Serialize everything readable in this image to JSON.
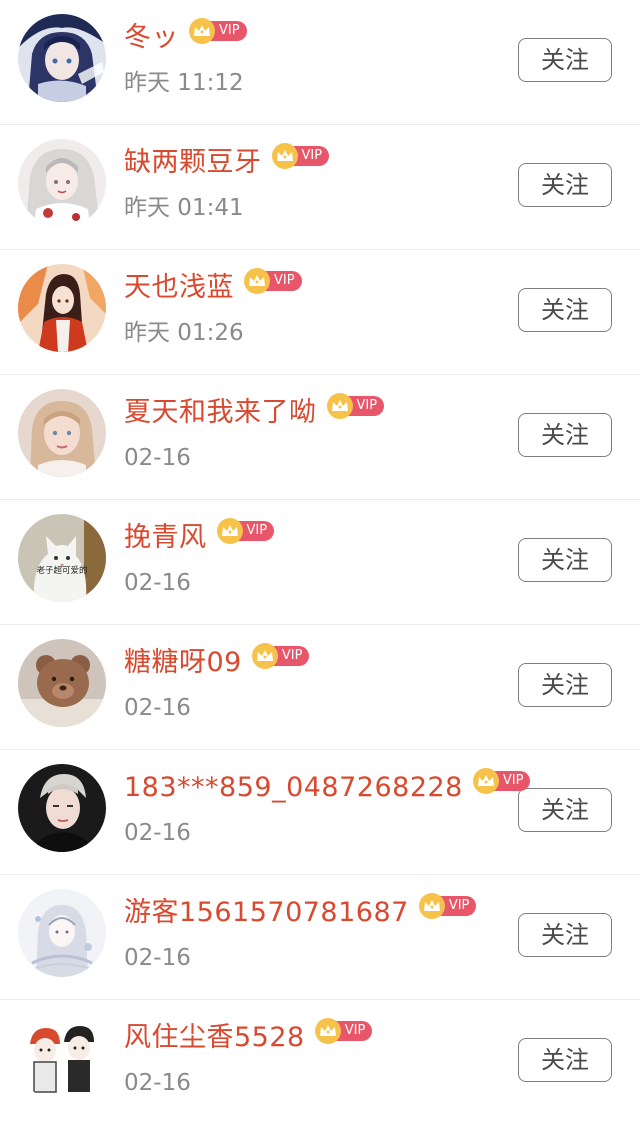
{
  "vip_label": "VIP",
  "follow_label": "关注",
  "colors": {
    "name": "#d9492f",
    "time": "#8a8a8a",
    "vip_crown": "#f6c24a",
    "vip_tag": "#e8566a",
    "button_border": "#7f7f7f",
    "divider": "#ececec"
  },
  "users": [
    {
      "name": "冬ッ",
      "time": "昨天 11:12",
      "avatar_icon": "anime-girl-blue-avatar"
    },
    {
      "name": "缺两颗豆牙",
      "time": "昨天 01:41",
      "avatar_icon": "anime-girl-white-hair-avatar"
    },
    {
      "name": "天也浅蓝",
      "time": "昨天 01:26",
      "avatar_icon": "anime-girl-orange-robe-avatar"
    },
    {
      "name": "夏天和我来了呦",
      "time": "02-16",
      "avatar_icon": "girl-photo-avatar"
    },
    {
      "name": "挽青风",
      "time": "02-16",
      "avatar_icon": "white-cat-avatar",
      "avatar_caption": "老子超可爱的"
    },
    {
      "name": "糖糖呀09",
      "time": "02-16",
      "avatar_icon": "teddy-bear-avatar"
    },
    {
      "name": "183***859_0487268228",
      "time": "02-16",
      "avatar_icon": "man-portrait-avatar"
    },
    {
      "name": "游客1561570781687",
      "time": "02-16",
      "avatar_icon": "sketch-girl-avatar"
    },
    {
      "name": "风住尘香5528",
      "time": "02-16",
      "avatar_icon": "cartoon-couple-avatar"
    }
  ]
}
